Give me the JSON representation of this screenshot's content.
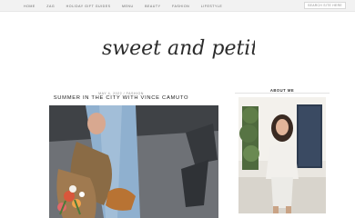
{
  "nav": {
    "items": [
      "HOME",
      "ZAG",
      "HOLIDAY GIFT GUIDES",
      "MENU",
      "BEAUTY",
      "FASHION",
      "LIFESTYLE"
    ],
    "search_label": "SEARCH SITE HERE"
  },
  "header": {
    "logo_text": "sweet and petite"
  },
  "post": {
    "meta": "MAY 4, 2022 / FASHION",
    "title": "SUMMER IN THE CITY WITH VINCE CAMUTO"
  },
  "sidebar": {
    "about_title": "ABOUT ME"
  },
  "colors": {
    "topbar": "#f2f2f2",
    "text_dark": "#222222",
    "text_muted": "#888888"
  }
}
